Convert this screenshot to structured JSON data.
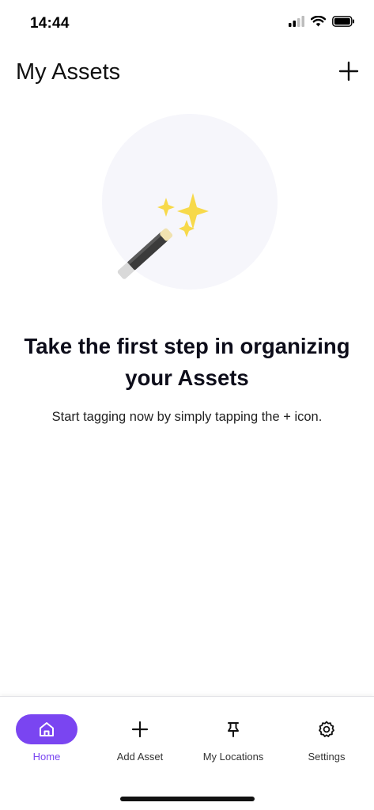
{
  "status_bar": {
    "time": "14:44",
    "icons": [
      "cellular-signal-icon",
      "wifi-icon",
      "battery-icon"
    ]
  },
  "header": {
    "title": "My Assets",
    "add_icon": "plus-icon"
  },
  "empty_state": {
    "illustration": "magic-wand-icon",
    "heading": "Take the first step in organizing your Assets",
    "subtext": "Start tagging now by simply tapping the + icon."
  },
  "tab_bar": {
    "active_index": 0,
    "tabs": [
      {
        "label": "Home",
        "icon": "home-icon"
      },
      {
        "label": "Add Asset",
        "icon": "plus-icon"
      },
      {
        "label": "My Locations",
        "icon": "pin-icon"
      },
      {
        "label": "Settings",
        "icon": "gear-icon"
      }
    ]
  },
  "colors": {
    "accent": "#7a45f1",
    "hero_background": "#f6f6fb",
    "text_primary": "#0d0d1a"
  }
}
